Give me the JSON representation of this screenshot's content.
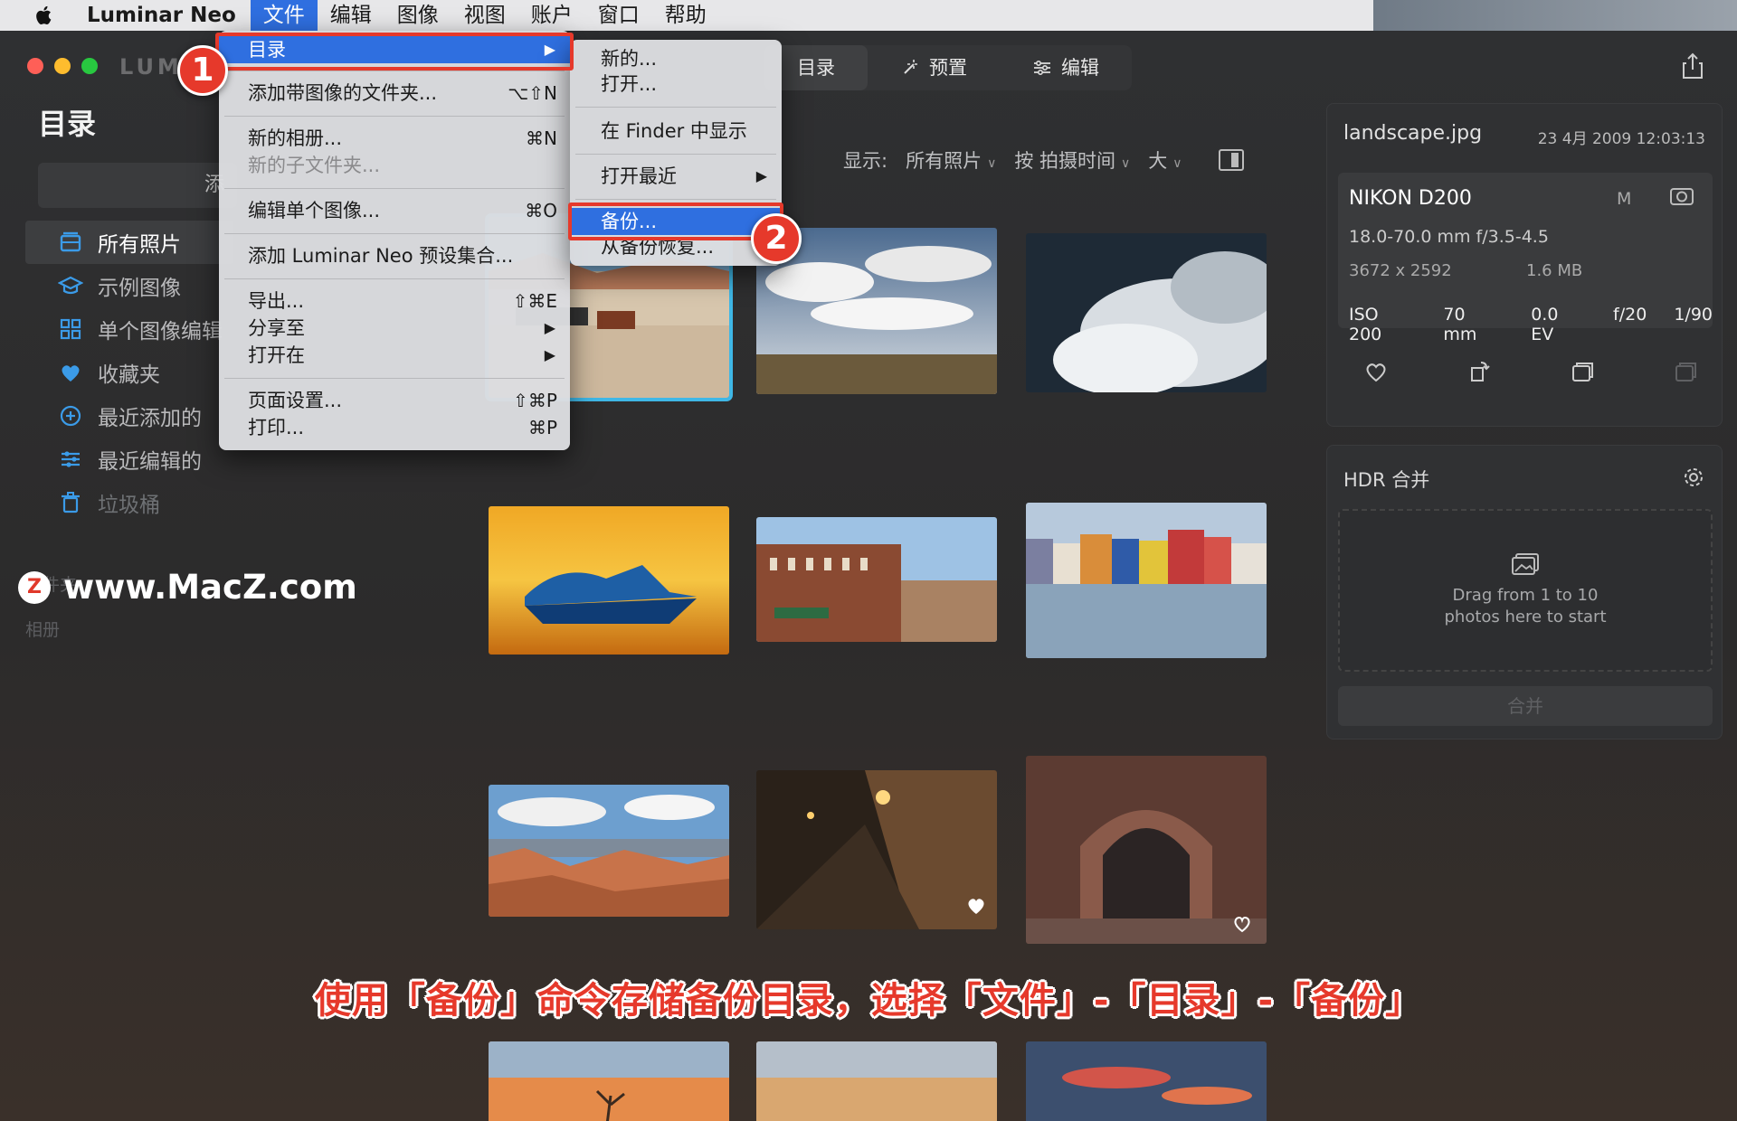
{
  "menubar": {
    "app_name": "Luminar Neo",
    "items": [
      "文件",
      "编辑",
      "图像",
      "视图",
      "账户",
      "窗口",
      "帮助"
    ]
  },
  "window": {
    "logo_partial": "LUM",
    "top_tabs": [
      {
        "label": "目录",
        "icon": "catalog-icon"
      },
      {
        "label": "预置",
        "icon": "presets-icon"
      },
      {
        "label": "编辑",
        "icon": "sliders-icon"
      }
    ]
  },
  "sidebar": {
    "title": "目录",
    "add_button_partial": "添",
    "items": [
      {
        "label": "所有照片",
        "icon": "photos-icon"
      },
      {
        "label": "示例图像",
        "icon": "graduation-cap-icon"
      },
      {
        "label": "单个图像编辑",
        "icon": "grid-icon"
      },
      {
        "label": "收藏夹",
        "icon": "heart-icon"
      },
      {
        "label": "最近添加的",
        "icon": "plus-circle-icon"
      },
      {
        "label": "最近编辑的",
        "icon": "sliders-icon"
      },
      {
        "label": "垃圾桶",
        "icon": "trash-icon"
      }
    ],
    "section_folders": "文件夹",
    "section_albums": "相册"
  },
  "watermark": {
    "logo": "Z",
    "text": "www.MacZ.com"
  },
  "filters": {
    "show_label": "显示:",
    "show_value": "所有照片",
    "sort_value": "按 拍摄时间",
    "size_value": "大"
  },
  "info": {
    "filename": "landscape.jpg",
    "date": "23 4月 2009 12:03:13",
    "camera": "NIKON D200",
    "mode": "M",
    "lens": "18.0-70.0 mm f/3.5-4.5",
    "dimensions": "3672 x 2592",
    "filesize": "1.6 MB",
    "exif": [
      "ISO 200",
      "70 mm",
      "0.0 EV",
      "f/20",
      "1/90"
    ]
  },
  "hdr": {
    "title": "HDR 合并",
    "drop_line1": "Drag from 1 to 10",
    "drop_line2": "photos here to start",
    "merge_label": "合并"
  },
  "file_menu": {
    "catalog": "目录",
    "add_folder": "添加带图像的文件夹...",
    "add_folder_sc": "⌥⇧N",
    "new_album": "新的相册...",
    "new_album_sc": "⌘N",
    "new_subfolder": "新的子文件夹...",
    "edit_single": "编辑单个图像...",
    "edit_single_sc": "⌘O",
    "add_preset": "添加 Luminar Neo 预设集合...",
    "export": "导出...",
    "export_sc": "⇧⌘E",
    "share": "分享至",
    "open_in": "打开在",
    "page_setup": "页面设置...",
    "page_setup_sc": "⇧⌘P",
    "print": "打印...",
    "print_sc": "⌘P"
  },
  "catalog_submenu": {
    "new": "新的...",
    "open": "打开...",
    "show_finder": "在 Finder 中显示",
    "open_recent": "打开最近",
    "backup": "备份...",
    "restore": "从备份恢复..."
  },
  "annotations": {
    "step1": "1",
    "step2": "2",
    "caption": "使用「备份」命令存储备份目录，选择「文件」-「目录」-「备份」"
  },
  "colors": {
    "accent": "#2f6fe0",
    "annotation_red": "#e6392b",
    "sidebar_icon_blue": "#3b9be8",
    "selection_cyan": "#3fb7e6"
  }
}
